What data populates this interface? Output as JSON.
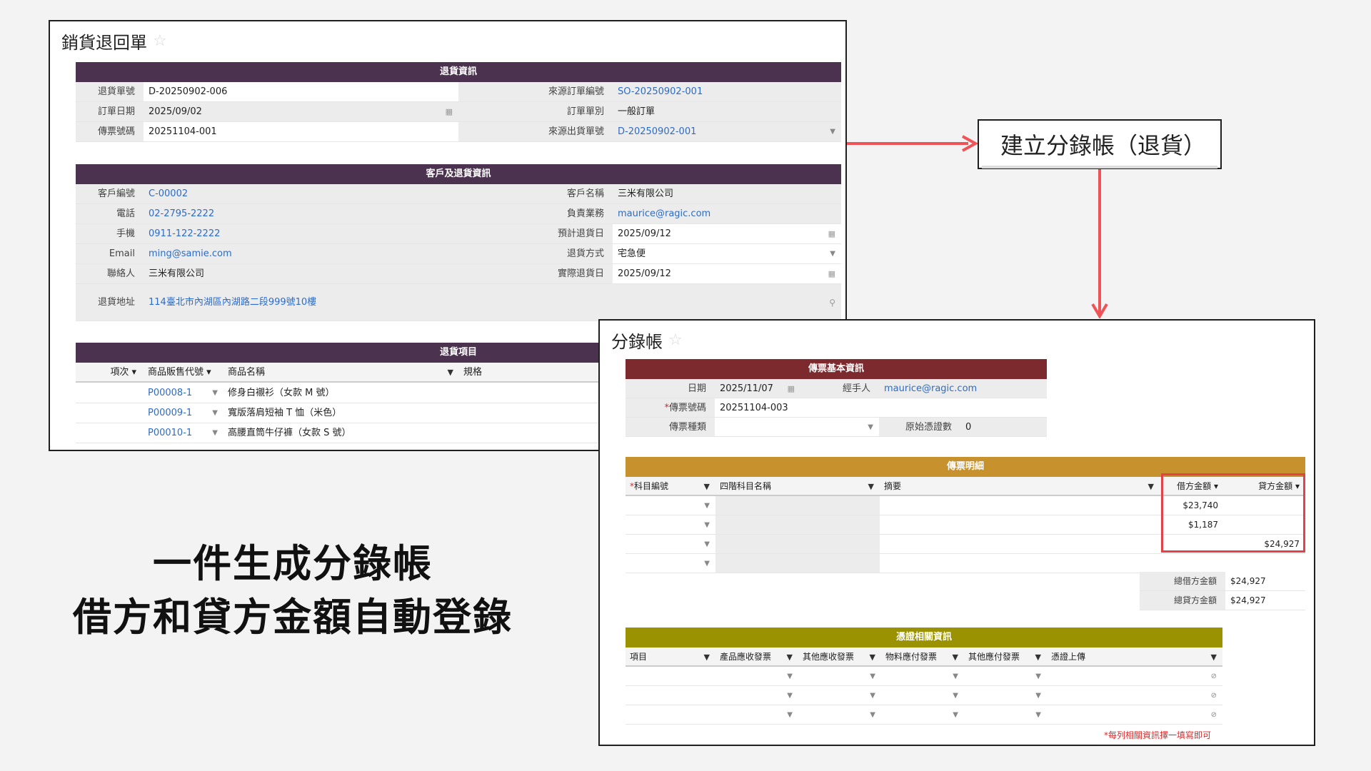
{
  "return_form": {
    "title": "銷貨退回單",
    "sections": {
      "return_info": "退貨資訊",
      "customer_info": "客戶及退貨資訊",
      "return_items": "退貨項目"
    },
    "fields": {
      "return_no_label": "退貨單號",
      "return_no": "D-20250902-006",
      "order_date_label": "訂單日期",
      "order_date": "2025/09/02",
      "voucher_no_label": "傳票號碼",
      "voucher_no": "20251104-001",
      "src_order_label": "來源訂單編號",
      "src_order": "SO-20250902-001",
      "order_type_label": "訂單單別",
      "order_type": "一般訂單",
      "src_ship_label": "來源出貨單號",
      "src_ship": "D-20250902-001",
      "cust_no_label": "客戶編號",
      "cust_no": "C-00002",
      "phone_label": "電話",
      "phone": "02-2795-2222",
      "mobile_label": "手機",
      "mobile": "0911-122-2222",
      "email_label": "Email",
      "email": "ming@samie.com",
      "contact_label": "聯絡人",
      "contact": "三米有限公司",
      "cust_name_label": "客戶名稱",
      "cust_name": "三米有限公司",
      "sales_label": "負責業務",
      "sales": "maurice@ragic.com",
      "exp_date_label": "預計退貨日",
      "exp_date": "2025/09/12",
      "method_label": "退貨方式",
      "method": "宅急便",
      "act_date_label": "實際退貨日",
      "act_date": "2025/09/12",
      "address_label": "退貨地址",
      "address": "114臺北市內湖區內湖路二段999號10樓"
    },
    "item_columns": [
      "項次",
      "商品販售代號",
      "商品名稱",
      "規格"
    ],
    "items": [
      {
        "code": "P00008-1",
        "name": "修身白襯衫（女款 M 號）"
      },
      {
        "code": "P00009-1",
        "name": "寬版落肩短袖 T 恤（米色）"
      },
      {
        "code": "P00010-1",
        "name": "高腰直筒牛仔褲（女款 S 號）"
      }
    ]
  },
  "callout": {
    "label": "建立分錄帳（退貨）"
  },
  "journal": {
    "title": "分錄帳",
    "sections": {
      "basic": "傳票基本資訊",
      "detail": "傳票明細",
      "proof": "憑證相關資訊"
    },
    "fields": {
      "date_label": "日期",
      "date": "2025/11/07",
      "handler_label": "經手人",
      "handler": "maurice@ragic.com",
      "voucher_label": "傳票號碼",
      "voucher": "20251104-003",
      "type_label": "傳票種類",
      "type": "",
      "orig_label": "原始憑證數",
      "orig": "0"
    },
    "detail_columns": [
      "科目編號",
      "四階科目名稱",
      "摘要",
      "借方金額",
      "貸方金額"
    ],
    "detail_rows": [
      {
        "debit": "$23,740",
        "credit": ""
      },
      {
        "debit": "$1,187",
        "credit": ""
      },
      {
        "debit": "",
        "credit": "$24,927"
      },
      {
        "debit": "",
        "credit": ""
      }
    ],
    "totals": {
      "debit_label": "總借方金額",
      "debit": "$24,927",
      "credit_label": "總貸方金額",
      "credit": "$24,927"
    },
    "proof_columns": [
      "項目",
      "產品應收發票",
      "其他應收發票",
      "物料應付發票",
      "其他應付發票",
      "憑證上傳"
    ],
    "proof_note": "*每列相關資訊擇一填寫即可"
  },
  "headline": {
    "line1": "一件生成分錄帳",
    "line2": "借方和貸方金額自動登錄"
  },
  "colors": {
    "plum": "#4b3350",
    "red": "#7c2a2e",
    "ochre": "#c7922e",
    "olive": "#9a9200",
    "arrow": "#ef5357",
    "link": "#2d6cc4"
  }
}
